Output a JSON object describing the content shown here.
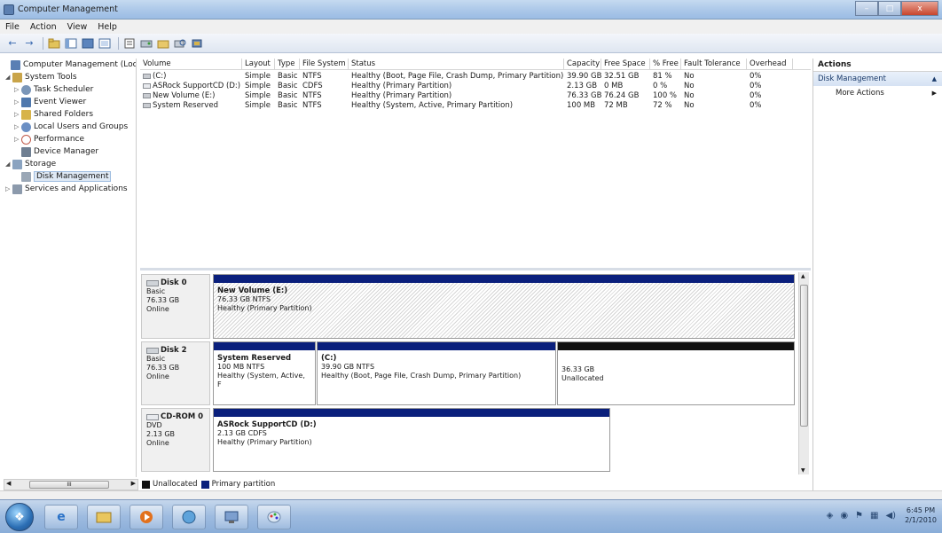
{
  "window": {
    "title": "Computer Management",
    "min_glyph": "–",
    "max_glyph": "□",
    "close_glyph": "x"
  },
  "menu": [
    "File",
    "Action",
    "View",
    "Help"
  ],
  "toolbar": {
    "back": "←",
    "forward": "→"
  },
  "tree": [
    {
      "label": "Computer Management (Local",
      "expander": "",
      "icon": "computer-icon",
      "color": "#5a7fb4"
    },
    {
      "label": "System Tools",
      "expander": "◢",
      "icon": "toolbox-icon",
      "color": "#c9a449"
    },
    {
      "label": "Task Scheduler",
      "expander": "▷",
      "icon": "clock-icon",
      "color": "#7a96b8"
    },
    {
      "label": "Event Viewer",
      "expander": "▷",
      "icon": "event-viewer-icon",
      "color": "#4f78ad"
    },
    {
      "label": "Shared Folders",
      "expander": "▷",
      "icon": "shared-folder-icon",
      "color": "#d7b34a"
    },
    {
      "label": "Local Users and Groups",
      "expander": "▷",
      "icon": "users-icon",
      "color": "#6b8fc4"
    },
    {
      "label": "Performance",
      "expander": "▷",
      "icon": "performance-icon",
      "color": "#c05a4a"
    },
    {
      "label": "Device Manager",
      "expander": "",
      "icon": "device-manager-icon",
      "color": "#6f7f92"
    },
    {
      "label": "Storage",
      "expander": "◢",
      "icon": "storage-icon",
      "color": "#8aa3c0"
    },
    {
      "label": "Disk Management",
      "expander": "",
      "icon": "disk-management-icon",
      "color": "#9aa7b6"
    },
    {
      "label": "Services and Applications",
      "expander": "▷",
      "icon": "services-icon",
      "color": "#8c9aac"
    }
  ],
  "volumes": {
    "headers": [
      "Volume",
      "Layout",
      "Type",
      "File System",
      "Status",
      "Capacity",
      "Free Space",
      "% Free",
      "Fault Tolerance",
      "Overhead"
    ],
    "rows": [
      [
        "(C:)",
        "Simple",
        "Basic",
        "NTFS",
        "Healthy (Boot, Page File, Crash Dump, Primary Partition)",
        "39.90 GB",
        "32.51 GB",
        "81 %",
        "No",
        "0%"
      ],
      [
        "ASRock SupportCD (D:)",
        "Simple",
        "Basic",
        "CDFS",
        "Healthy (Primary Partition)",
        "2.13 GB",
        "0 MB",
        "0 %",
        "No",
        "0%"
      ],
      [
        "New Volume (E:)",
        "Simple",
        "Basic",
        "NTFS",
        "Healthy (Primary Partition)",
        "76.33 GB",
        "76.24 GB",
        "100 %",
        "No",
        "0%"
      ],
      [
        "System Reserved",
        "Simple",
        "Basic",
        "NTFS",
        "Healthy (System, Active, Primary Partition)",
        "100 MB",
        "72 MB",
        "72 %",
        "No",
        "0%"
      ]
    ]
  },
  "disks": [
    {
      "name": "Disk 0",
      "kind": "Basic",
      "size": "76.33 GB",
      "state": "Online"
    },
    {
      "name": "Disk 2",
      "kind": "Basic",
      "size": "76.33 GB",
      "state": "Online"
    },
    {
      "name": "CD-ROM 0",
      "kind": "DVD",
      "size": "2.13 GB",
      "state": "Online"
    }
  ],
  "partitions": {
    "disk0_e": {
      "name": "New Volume  (E:)",
      "fs": "76.33 GB NTFS",
      "status": "Healthy (Primary Partition)"
    },
    "disk2_sysres": {
      "name": "System Reserved",
      "fs": "100 MB NTFS",
      "status": "Healthy (System, Active, F"
    },
    "disk2_c": {
      "name": "(C:)",
      "fs": "39.90 GB NTFS",
      "status": "Healthy (Boot, Page File, Crash Dump, Primary Partition)"
    },
    "disk2_unalloc": {
      "size": "36.33 GB",
      "status": "Unallocated"
    },
    "cdrom_d": {
      "name": "ASRock SupportCD  (D:)",
      "fs": "2.13 GB CDFS",
      "status": "Healthy (Primary Partition)"
    }
  },
  "legend": {
    "unallocated": "Unallocated",
    "primary": "Primary partition",
    "unallocated_color": "#111111",
    "primary_color": "#0a1f7c"
  },
  "actions": {
    "header": "Actions",
    "section": "Disk Management",
    "items": [
      "More Actions"
    ]
  },
  "taskbar": {
    "clock_time": "6:45 PM",
    "clock_date": "2/1/2010"
  }
}
